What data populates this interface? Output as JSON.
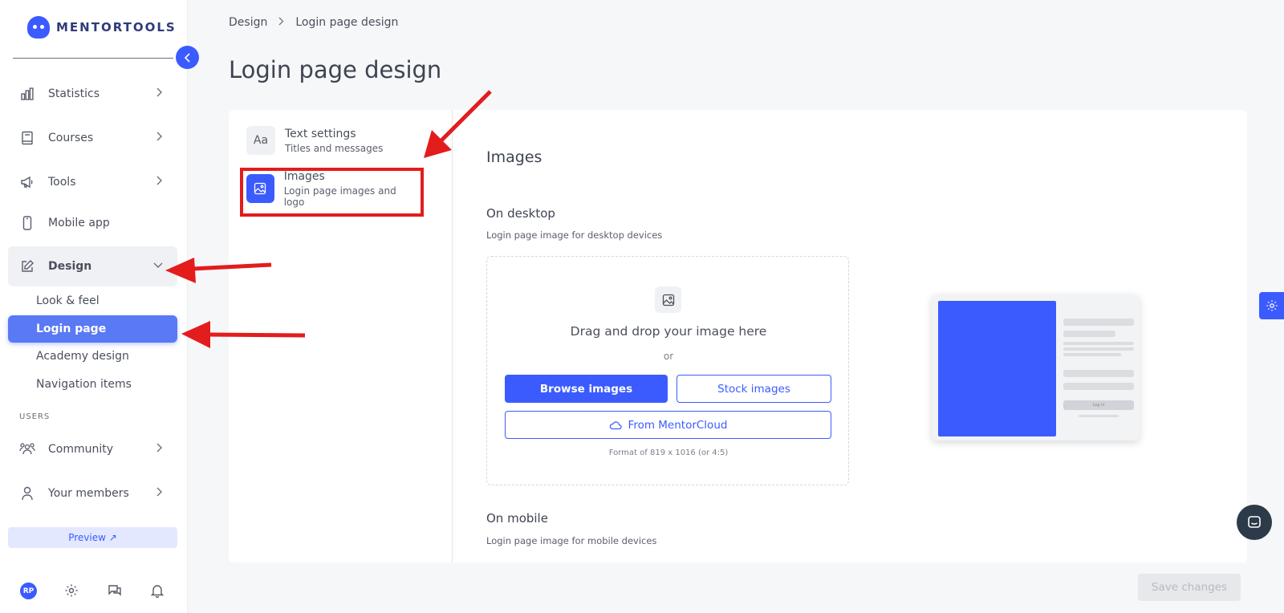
{
  "app": {
    "logo_text": "MENTORTOOLS"
  },
  "sidebar": {
    "items": [
      {
        "label": "Statistics",
        "icon": "bar-chart-icon"
      },
      {
        "label": "Courses",
        "icon": "book-icon"
      },
      {
        "label": "Tools",
        "icon": "megaphone-icon"
      },
      {
        "label": "Mobile app",
        "icon": "phone-icon"
      },
      {
        "label": "Design",
        "icon": "pencil-icon"
      }
    ],
    "design_sub": [
      "Look & feel",
      "Login page",
      "Academy design",
      "Navigation items"
    ],
    "users_section": "USERS",
    "user_items": [
      {
        "label": "Community",
        "icon": "people-icon"
      },
      {
        "label": "Your members",
        "icon": "person-icon"
      }
    ],
    "preview_label": "Preview ↗",
    "avatar_initials": "RP"
  },
  "breadcrumb": {
    "parent": "Design",
    "current": "Login page design"
  },
  "page_title": "Login page design",
  "settings_menu": [
    {
      "title": "Text settings",
      "subtitle": "Titles and messages",
      "icon_glyph": "Aa"
    },
    {
      "title": "Images",
      "subtitle": "Login page images and logo"
    }
  ],
  "images_section": {
    "title": "Images",
    "desktop_title": "On desktop",
    "desktop_desc": "Login page image for desktop devices",
    "dropzone": {
      "title": "Drag and drop your image here",
      "or": "or",
      "browse": "Browse images",
      "stock": "Stock images",
      "cloud": "From MentorCloud",
      "format": "Format of 819 x 1016 (or 4:5)"
    },
    "mobile_title": "On mobile",
    "mobile_desc": "Login page image for mobile devices"
  },
  "mockup": {
    "button_text": "Log in"
  },
  "save_label": "Save changes",
  "colors": {
    "accent": "#3b5bff",
    "annotation": "#e31c1c"
  }
}
